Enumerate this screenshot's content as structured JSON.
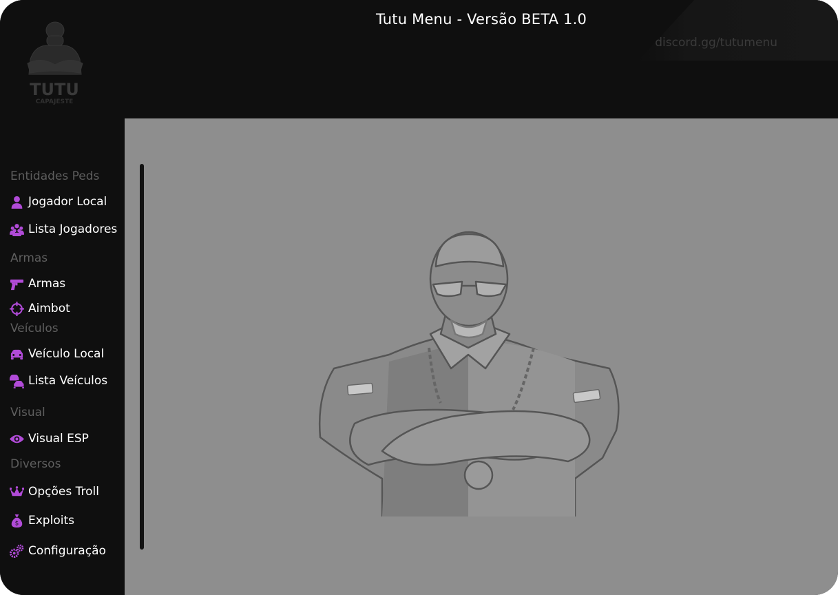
{
  "header": {
    "title": "Tutu Menu - Versão BETA 1.0",
    "discord": "discord.gg/tutumenu"
  },
  "logo": {
    "text": "TUTU",
    "subtext": "CAPAJESTE"
  },
  "sidebar": {
    "sections": [
      {
        "label": "Entidades Peds"
      },
      {
        "label": "Armas"
      },
      {
        "label": "Veículos"
      },
      {
        "label": "Visual"
      },
      {
        "label": "Diversos"
      }
    ],
    "items": [
      {
        "label": "Jogador Local",
        "icon": "user-icon"
      },
      {
        "label": "Lista Jogadores",
        "icon": "users-icon"
      },
      {
        "label": "Armas",
        "icon": "gun-icon"
      },
      {
        "label": "Aimbot",
        "icon": "crosshair-icon"
      },
      {
        "label": "Veículo Local",
        "icon": "car-icon"
      },
      {
        "label": "Lista Veículos",
        "icon": "cars-icon"
      },
      {
        "label": "Visual ESP",
        "icon": "eye-icon"
      },
      {
        "label": "Opções Troll",
        "icon": "jester-hat-icon"
      },
      {
        "label": "Exploits",
        "icon": "money-bag-icon"
      },
      {
        "label": "Configuração",
        "icon": "gears-icon"
      }
    ]
  },
  "colors": {
    "accent": "#b14bd8",
    "background": "#0f0f0f",
    "content": "#8e8e8e",
    "section": "#5e5e5e"
  }
}
